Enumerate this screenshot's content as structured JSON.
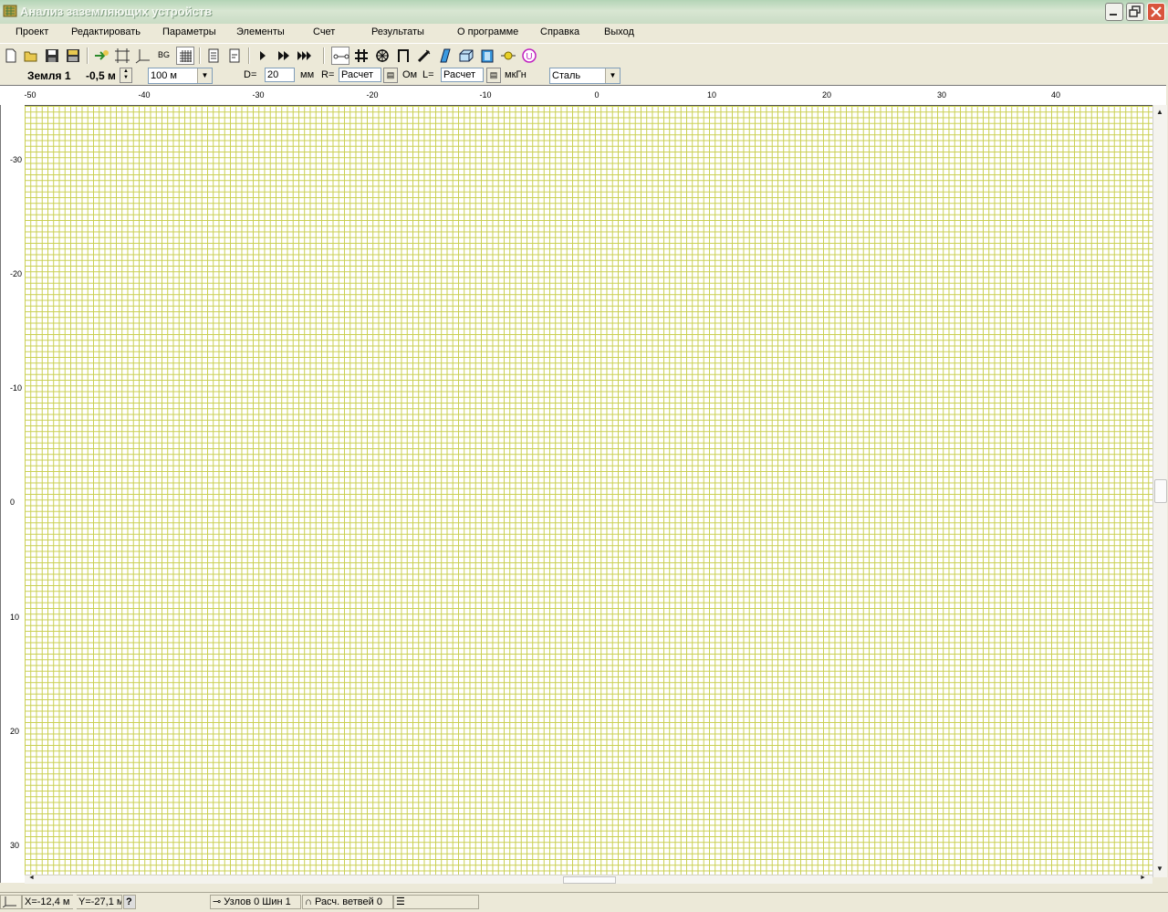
{
  "window": {
    "title": "Анализ заземляющих устройств"
  },
  "menu": [
    "Проект",
    "Редактировать",
    "Параметры",
    "Элементы",
    "Счет",
    "Результаты",
    "О программе",
    "Справка",
    "Выход"
  ],
  "toolbar": {
    "bg_label": "BG",
    "ground_tool_label": "U"
  },
  "propbar": {
    "layer": "Земля 1",
    "depth": "-0,5 м",
    "length_select": "100 м",
    "d_label": "D=",
    "d_value": "20",
    "d_unit": "мм",
    "r_label": "R=",
    "r_value": "Расчет",
    "r_unit": "Ом",
    "l_label": "L=",
    "l_value": "Расчет",
    "l_unit": "мкГн",
    "material_select": "Сталь"
  },
  "hruler": [
    "-50",
    "-40",
    "-30",
    "-20",
    "-10",
    "0",
    "10",
    "20",
    "30",
    "40"
  ],
  "vruler": [
    "-30",
    "-20",
    "-10",
    "0",
    "10",
    "20",
    "30"
  ],
  "statusbar": {
    "x": "X=-12,4 м",
    "y": "Y=-27,1 м",
    "help": "?",
    "nodes": "Узлов 0 Шин 1",
    "branches": "Расч. ветвей 0"
  },
  "colors": {
    "grid_line": "#c9cf4e",
    "title_bar": "#c9dcc5",
    "face": "#ece9d8"
  }
}
